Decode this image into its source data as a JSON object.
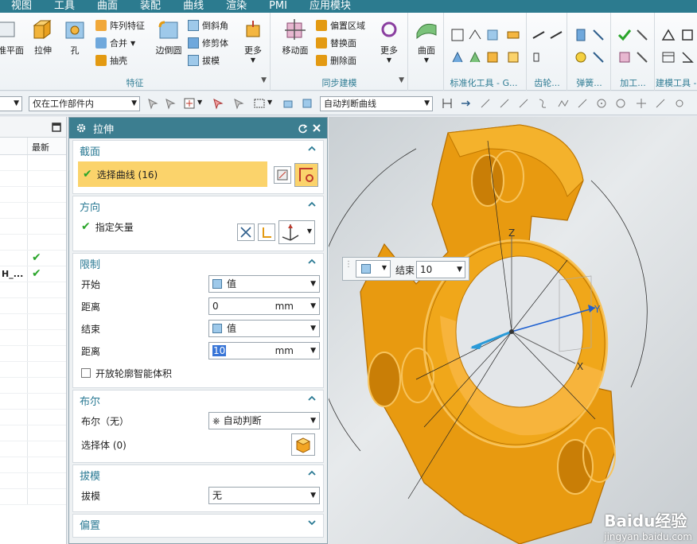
{
  "menu": [
    "视图",
    "工具",
    "曲面",
    "装配",
    "曲线",
    "渲染",
    "PMI",
    "应用模块"
  ],
  "ribbon": {
    "features": {
      "label": "特征",
      "big_buttons": [
        "基准平面",
        "拉伸",
        "孔"
      ],
      "small_buttons": [
        "阵列特征",
        "合并",
        "抽壳"
      ],
      "edge_blend": "边倒圆",
      "small_buttons2": [
        "倒斜角",
        "修剪体",
        "拔模"
      ],
      "more": "更多"
    },
    "sync": {
      "label": "同步建模",
      "move_face": "移动面",
      "small_buttons": [
        "偏置区域",
        "替换面",
        "删除面"
      ],
      "more": "更多"
    },
    "surface": {
      "big_button": "曲面"
    },
    "small_groups": [
      "标准化工具 - G...",
      "齿轮...",
      "弹簧...",
      "加工...",
      "建模工具 - ..."
    ]
  },
  "toolbar2": {
    "left_combo": "",
    "scope_combo": "仅在工作部件内",
    "curve_rule_combo": "自动判断曲线"
  },
  "navigator": {
    "col_latest": "最新",
    "rows": [
      {
        "name": "",
        "check": false
      },
      {
        "name": "",
        "check": false
      },
      {
        "name": "",
        "check": false
      },
      {
        "name": "",
        "check": false
      },
      {
        "name": "",
        "check": false
      },
      {
        "name": "",
        "check": false
      },
      {
        "name": "",
        "check": true
      },
      {
        "name": "H_...",
        "check": true
      }
    ],
    "check_mark": "✔"
  },
  "dialog": {
    "title": "拉伸",
    "section_curve": {
      "title": "截面",
      "select_curve": "选择曲线 (16)"
    },
    "direction": {
      "title": "方向",
      "specify_vector": "指定矢量"
    },
    "limits": {
      "title": "限制",
      "start_label": "开始",
      "start_value": "值",
      "distance_label": "距离",
      "start_distance": "0",
      "end_label": "结束",
      "end_value": "值",
      "distance_label2": "距离",
      "end_distance": "10",
      "unit": "mm",
      "open_profile": "开放轮廓智能体积"
    },
    "boolean": {
      "title": "布尔",
      "boolean_label": "布尔（无）",
      "boolean_value": "自动判断",
      "select_body": "选择体 (0)"
    },
    "draft": {
      "title": "拔模",
      "draft_label": "拔模",
      "draft_value": "无"
    },
    "offset": {
      "title": "偏置"
    }
  },
  "floatbar": {
    "end_label": "结束",
    "end_value": "10"
  },
  "viewport": {
    "axis_z": "Z",
    "axis_y": "Y",
    "axis_x": "X"
  },
  "watermark": {
    "text": "Baidu经验",
    "url_text": "jingyan.baidu.com"
  },
  "colors": {
    "menu_bg": "#2c7b8f",
    "dialog_title_bg": "#3c7e90",
    "accent_teal": "#2b7a94",
    "selection_yellow": "#fbd36b",
    "part_orange": "#e39a12",
    "check_green": "#2aa52a"
  }
}
